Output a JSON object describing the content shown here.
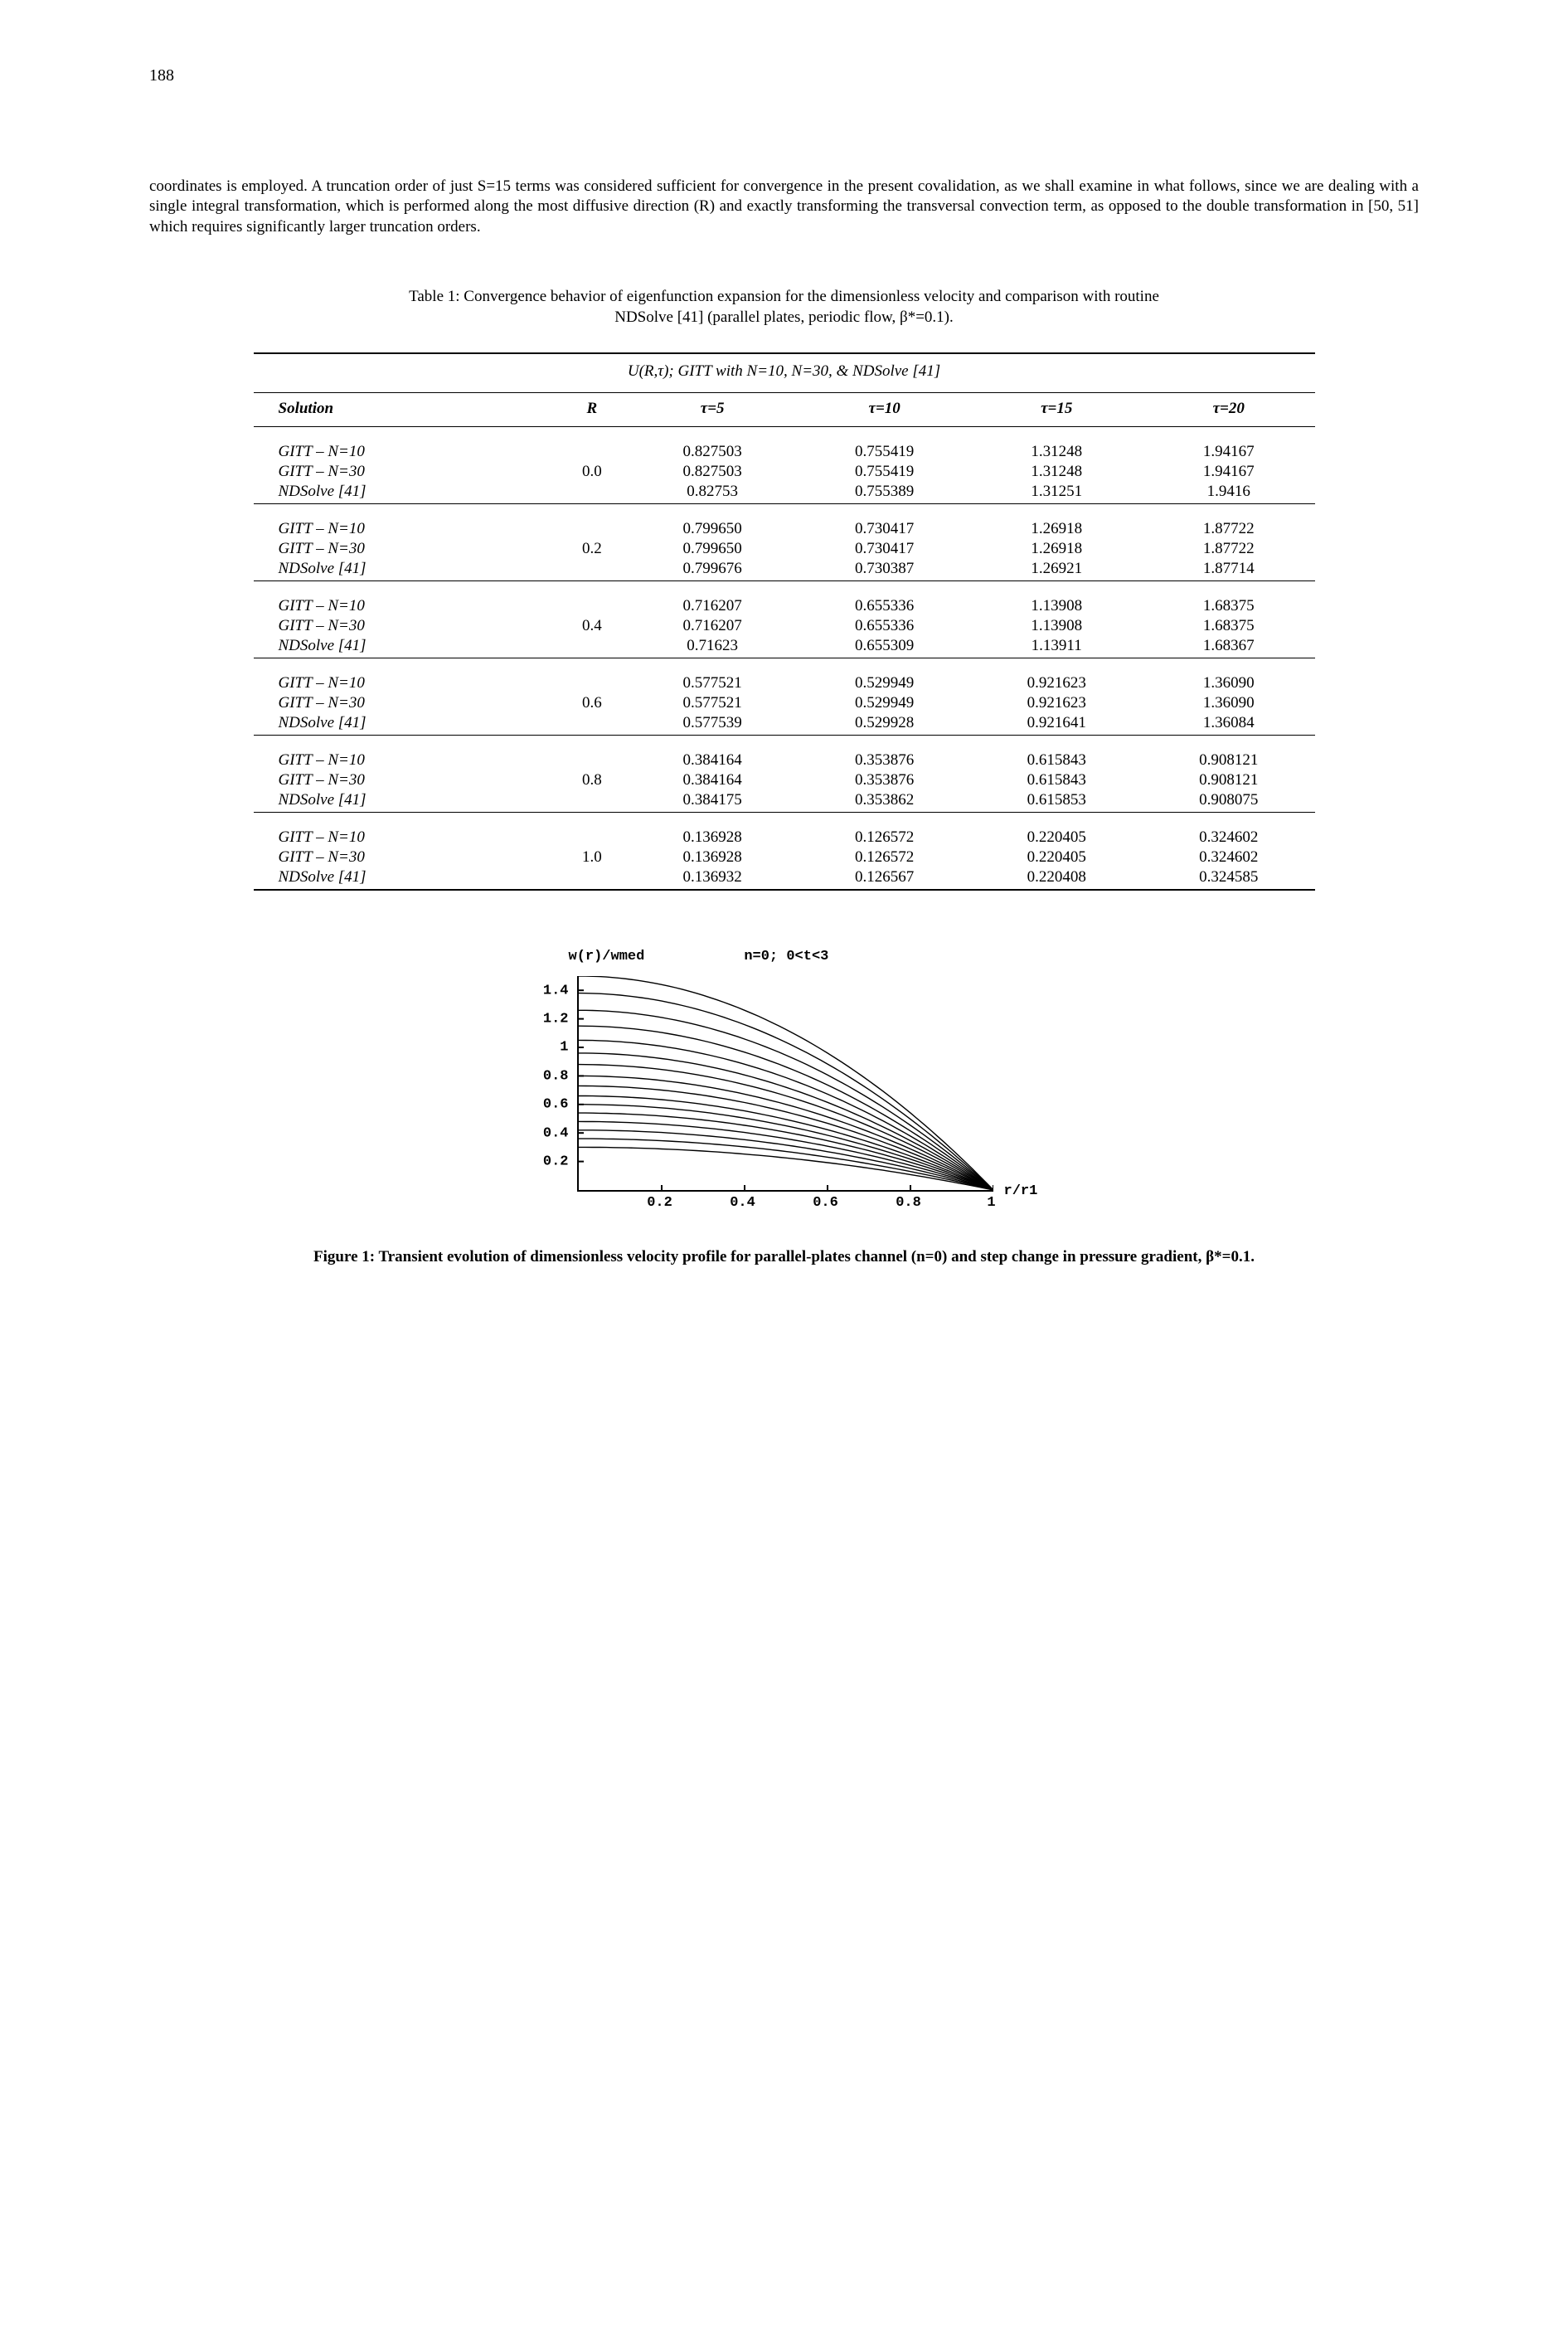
{
  "page_number": "188",
  "paragraph": "coordinates is employed. A truncation order of just S=15 terms was considered sufficient for convergence in the present covalidation, as we shall examine in what follows, since we are dealing with a single integral transformation, which is performed along the most diffusive direction (R) and exactly transforming the transversal convection term, as opposed to the double transformation in [50, 51] which requires significantly larger truncation orders.",
  "table_caption_line1": "Table 1: Convergence behavior of eigenfunction expansion for the dimensionless velocity and comparison with routine",
  "table_caption_line2": "NDSolve [41] (parallel plates, periodic flow, β*=0.1).",
  "table_title": "U(R,τ); GITT with N=10, N=30, & NDSolve [41]",
  "headers": {
    "solution": "Solution",
    "R": "R",
    "t5": "τ=5",
    "t10": "τ=10",
    "t15": "τ=15",
    "t20": "τ=20"
  },
  "row_labels": {
    "g10": "GITT – N=10",
    "g30": "GITT – N=30",
    "nds": "NDSolve [41]"
  },
  "groups": [
    {
      "R": "0.0",
      "rows": [
        [
          "0.827503",
          "0.755419",
          "1.31248",
          "1.94167"
        ],
        [
          "0.827503",
          "0.755419",
          "1.31248",
          "1.94167"
        ],
        [
          "0.82753",
          "0.755389",
          "1.31251",
          "1.9416"
        ]
      ]
    },
    {
      "R": "0.2",
      "rows": [
        [
          "0.799650",
          "0.730417",
          "1.26918",
          "1.87722"
        ],
        [
          "0.799650",
          "0.730417",
          "1.26918",
          "1.87722"
        ],
        [
          "0.799676",
          "0.730387",
          "1.26921",
          "1.87714"
        ]
      ]
    },
    {
      "R": "0.4",
      "rows": [
        [
          "0.716207",
          "0.655336",
          "1.13908",
          "1.68375"
        ],
        [
          "0.716207",
          "0.655336",
          "1.13908",
          "1.68375"
        ],
        [
          "0.71623",
          "0.655309",
          "1.13911",
          "1.68367"
        ]
      ]
    },
    {
      "R": "0.6",
      "rows": [
        [
          "0.577521",
          "0.529949",
          "0.921623",
          "1.36090"
        ],
        [
          "0.577521",
          "0.529949",
          "0.921623",
          "1.36090"
        ],
        [
          "0.577539",
          "0.529928",
          "0.921641",
          "1.36084"
        ]
      ]
    },
    {
      "R": "0.8",
      "rows": [
        [
          "0.384164",
          "0.353876",
          "0.615843",
          "0.908121"
        ],
        [
          "0.384164",
          "0.353876",
          "0.615843",
          "0.908121"
        ],
        [
          "0.384175",
          "0.353862",
          "0.615853",
          "0.908075"
        ]
      ]
    },
    {
      "R": "1.0",
      "rows": [
        [
          "0.136928",
          "0.126572",
          "0.220405",
          "0.324602"
        ],
        [
          "0.136928",
          "0.126572",
          "0.220405",
          "0.324602"
        ],
        [
          "0.136932",
          "0.126567",
          "0.220408",
          "0.324585"
        ]
      ]
    }
  ],
  "chart_data": {
    "type": "line",
    "ylabel": "w(r)/wmed",
    "annotation": "n=0; 0<t<3",
    "xlabel": "r/r1",
    "xlim": [
      0,
      1
    ],
    "ylim": [
      0,
      1.5
    ],
    "x_ticks": [
      "0.2",
      "0.4",
      "0.6",
      "0.8",
      "1"
    ],
    "y_ticks": [
      "0.2",
      "0.4",
      "0.6",
      "0.8",
      "1",
      "1.2",
      "1.4"
    ],
    "note": "Family of transient velocity profiles decaying from ~1.5 at r=0 to 0 at r=1; multiple time-level curves between t=0 and t=3."
  },
  "figure_caption_bold": "Figure 1: Transient evolution of dimensionless velocity profile for parallel-plates channel (n=0) and step change in pressure gradient, ",
  "figure_caption_tail": "β*=0.1."
}
